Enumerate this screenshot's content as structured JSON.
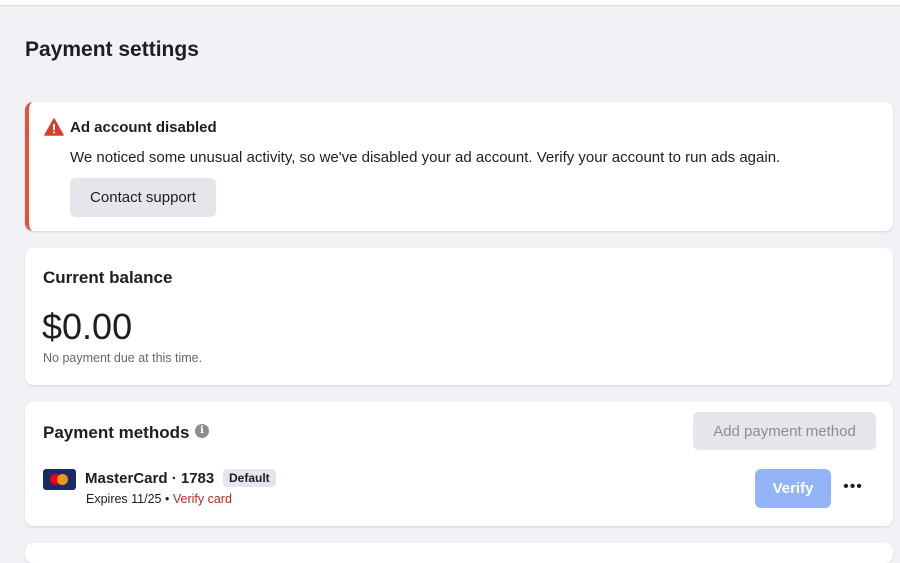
{
  "page": {
    "title": "Payment settings"
  },
  "alert": {
    "icon": "warning-triangle-icon",
    "title": "Ad account disabled",
    "message": "We noticed some unusual activity, so we've disabled your ad account. Verify your account to run ads again.",
    "button_label": "Contact support",
    "accent_color": "#e0523e"
  },
  "balance": {
    "heading": "Current balance",
    "amount": "$0.00",
    "note": "No payment due at this time."
  },
  "payment_methods": {
    "heading": "Payment methods",
    "info_icon": "info-icon",
    "add_button_label": "Add payment method",
    "methods": [
      {
        "brand_icon": "mastercard-icon",
        "name": "MasterCard · 1783",
        "badge": "Default",
        "expires": "Expires 11/25",
        "separator": " • ",
        "verify_link": "Verify card",
        "verify_button": "Verify",
        "more_icon": "more-horizontal-icon"
      }
    ]
  },
  "colors": {
    "background": "#f0f2f5",
    "link_red": "#c0271f",
    "primary_disabled": "#92b4f6"
  }
}
